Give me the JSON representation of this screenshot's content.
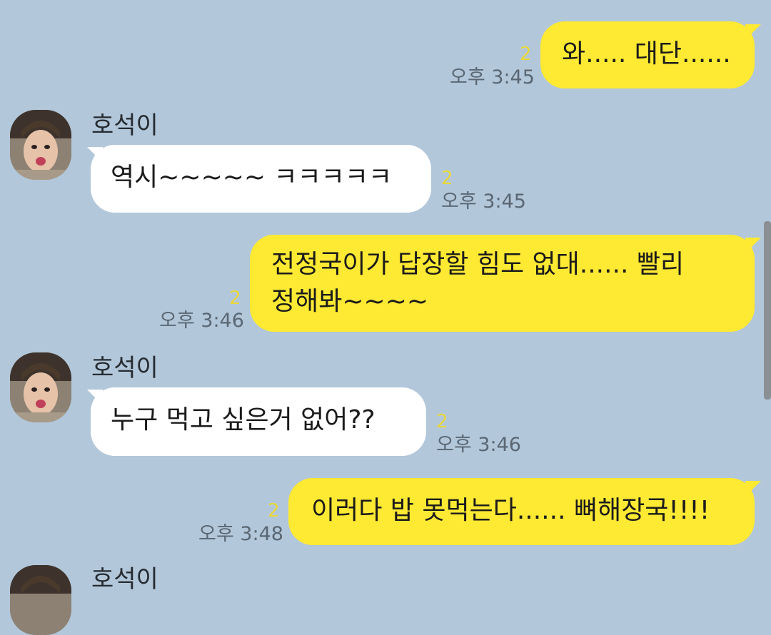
{
  "sender_name": "호석이",
  "messages": [
    {
      "from": "me",
      "text": "와..... 대단......",
      "unread": "2",
      "time": "오후 3:45"
    },
    {
      "from": "other",
      "text": "역시~~~~~ ㅋㅋㅋㅋㅋ",
      "unread": "2",
      "time": "오후 3:45"
    },
    {
      "from": "me",
      "lines": [
        "전정국이가 답장할 힘도 없대...... 빨리",
        "정해봐~~~~"
      ],
      "unread": "2",
      "time": "오후 3:46"
    },
    {
      "from": "other",
      "text": "누구 먹고 싶은거 없어??",
      "unread": "2",
      "time": "오후 3:46"
    },
    {
      "from": "me",
      "text": "이러다 밥 못먹는다...... 뼈해장국!!!!",
      "unread": "2",
      "time": "오후 3:48"
    }
  ],
  "colors": {
    "background": "#b2c7da",
    "my_bubble": "#fee933",
    "other_bubble": "#ffffff",
    "unread_count": "#e8d83a"
  },
  "icons": {
    "avatar": "profile-photo"
  }
}
